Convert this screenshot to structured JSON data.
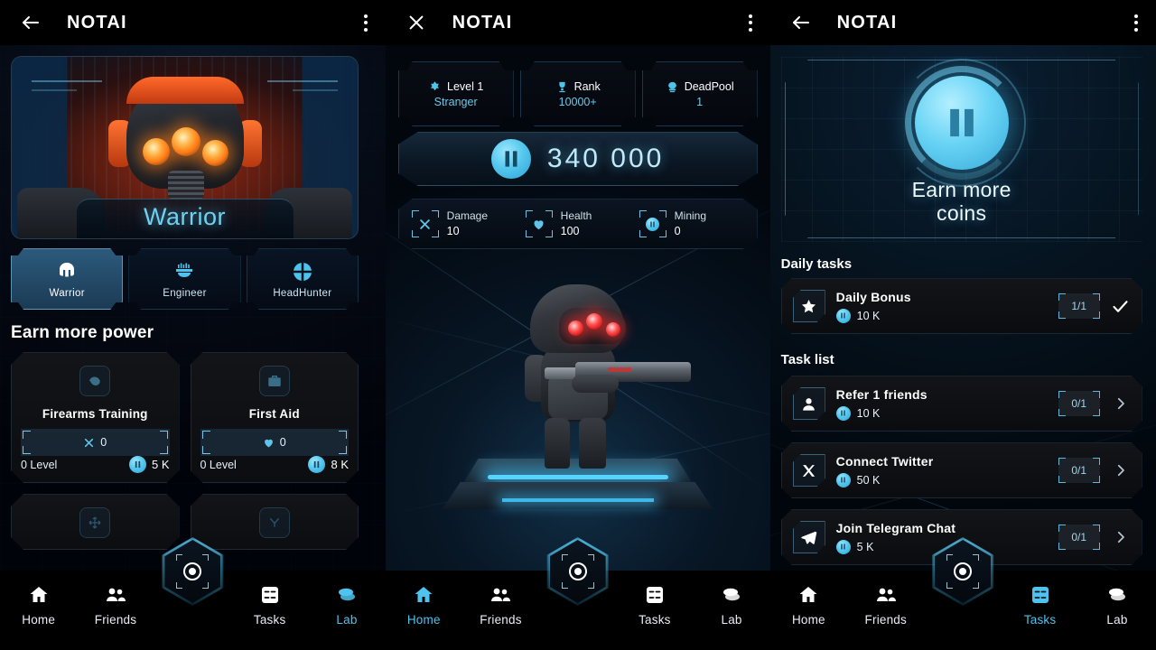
{
  "app": {
    "title": "NOTAI"
  },
  "panels": [
    {
      "id": "power",
      "topbar": {
        "left_icon": "back-arrow-icon",
        "title": "NOTAI",
        "menu_icon": "overflow-menu-icon"
      },
      "hero": {
        "name": "Warrior",
        "icon": "warrior-helmet-icon"
      },
      "class_tabs": [
        {
          "label": "Warrior",
          "icon": "warrior-helmet-icon",
          "active": true
        },
        {
          "label": "Engineer",
          "icon": "engineer-helmet-icon",
          "active": false
        },
        {
          "label": "HeadHunter",
          "icon": "crosshair-target-icon",
          "active": false
        }
      ],
      "section_title": "Earn more power",
      "power_cards": [
        {
          "name": "Firearms Training",
          "icon": "muscle-icon",
          "stat_icon": "damage-cross-icon",
          "stat_value": "0",
          "level": "0 Level",
          "price": "5 K"
        },
        {
          "name": "First Aid",
          "icon": "medkit-icon",
          "stat_icon": "health-heart-icon",
          "stat_value": "0",
          "level": "0 Level",
          "price": "8 K"
        }
      ],
      "partial_cards": [
        {
          "icon": "move-arrows-icon"
        },
        {
          "icon": "antenna-icon"
        }
      ],
      "nav": [
        {
          "label": "Home",
          "icon": "home-icon",
          "active": false
        },
        {
          "label": "Friends",
          "icon": "friends-icon",
          "active": false
        },
        {
          "label": "Tasks",
          "icon": "tasks-icon",
          "active": false
        },
        {
          "label": "Lab",
          "icon": "lab-coins-icon",
          "active": true
        }
      ],
      "center_button": {
        "icon": "target-crosshair-icon"
      }
    },
    {
      "id": "home",
      "topbar": {
        "left_icon": "close-x-icon",
        "title": "NOTAI",
        "menu_icon": "overflow-menu-icon"
      },
      "chips": [
        {
          "icon": "level-badge-icon",
          "label": "Level 1",
          "sub": "Stranger"
        },
        {
          "icon": "trophy-icon",
          "label": "Rank",
          "sub": "10000+"
        },
        {
          "icon": "deadpool-skull-icon",
          "label": "DeadPool",
          "sub": "1"
        }
      ],
      "balance": {
        "icon": "notai-coin-icon",
        "value": "340 000"
      },
      "stats": [
        {
          "icon": "damage-cross-icon",
          "label": "Damage",
          "value": "10"
        },
        {
          "icon": "health-heart-icon",
          "label": "Health",
          "value": "100"
        },
        {
          "icon": "mining-coin-icon",
          "label": "Mining",
          "value": "0"
        }
      ],
      "character": {
        "name": "soldier-avatar"
      },
      "nav": [
        {
          "label": "Home",
          "icon": "home-icon",
          "active": true
        },
        {
          "label": "Friends",
          "icon": "friends-icon",
          "active": false
        },
        {
          "label": "Tasks",
          "icon": "tasks-icon",
          "active": false
        },
        {
          "label": "Lab",
          "icon": "lab-coins-icon",
          "active": false
        }
      ],
      "center_button": {
        "icon": "target-crosshair-icon"
      }
    },
    {
      "id": "tasks",
      "topbar": {
        "left_icon": "back-arrow-icon",
        "title": "NOTAI",
        "menu_icon": "overflow-menu-icon"
      },
      "banner": {
        "icon": "notai-coin-icon",
        "title_line1": "Earn more",
        "title_line2": "coins"
      },
      "daily_heading": "Daily tasks",
      "daily_tasks": [
        {
          "icon": "star-icon",
          "name": "Daily Bonus",
          "reward": "10 K",
          "progress": "1/1",
          "end_icon": "check-icon"
        }
      ],
      "list_heading": "Task list",
      "tasks": [
        {
          "icon": "person-icon",
          "name": "Refer 1 friends",
          "reward": "10 K",
          "progress": "0/1",
          "end_icon": "chevron-right-icon"
        },
        {
          "icon": "twitter-x-icon",
          "name": "Connect Twitter",
          "reward": "50 K",
          "progress": "0/1",
          "end_icon": "chevron-right-icon"
        },
        {
          "icon": "telegram-icon",
          "name": "Join Telegram Chat",
          "reward": "5 K",
          "progress": "0/1",
          "end_icon": "chevron-right-icon"
        }
      ],
      "nav": [
        {
          "label": "Home",
          "icon": "home-icon",
          "active": false
        },
        {
          "label": "Friends",
          "icon": "friends-icon",
          "active": false
        },
        {
          "label": "Tasks",
          "icon": "tasks-icon",
          "active": true
        },
        {
          "label": "Lab",
          "icon": "lab-coins-icon",
          "active": false
        }
      ],
      "center_button": {
        "icon": "target-crosshair-icon"
      }
    }
  ],
  "colors": {
    "accent_cyan": "#4ec3ee",
    "coin_blue": "#56c8ef",
    "warrior_orange": "#ff7a15",
    "enemy_red": "#ff3b3b",
    "panel_bg": "#02040a"
  }
}
